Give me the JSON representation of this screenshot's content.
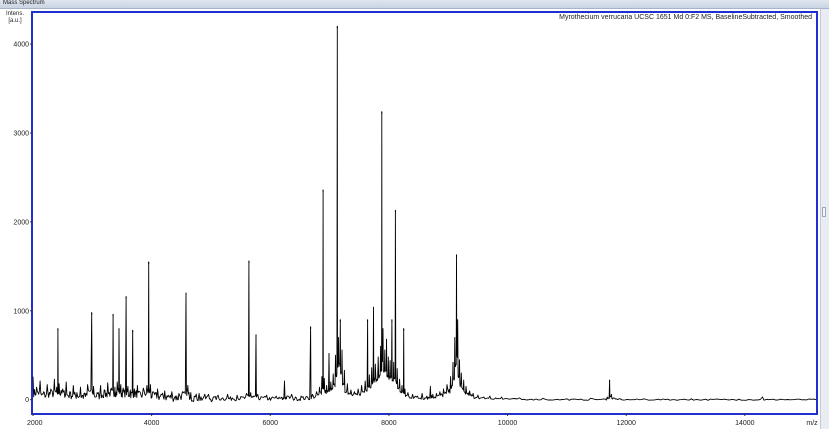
{
  "window": {
    "title": "Mass Spectrum"
  },
  "chart_data": {
    "type": "line",
    "title": "Myrothecium verrucaria UCSC 1651 Md 0:F2 MS, BaselineSubtracted, Smoothed",
    "xlabel": "m/z",
    "ylabel": "Intens. [a.u.]",
    "xlim": [
      2000,
      15200
    ],
    "ylim": [
      -150,
      4350
    ],
    "x_ticks": [
      2000,
      4000,
      6000,
      8000,
      10000,
      12000,
      14000
    ],
    "x_tick_labels": [
      "2000",
      "4000",
      "6000",
      "8000",
      "10000",
      "12000",
      "14000"
    ],
    "y_ticks": [
      0,
      1000,
      2000,
      3000,
      4000
    ],
    "y_tick_labels": [
      "0",
      "1000",
      "2000",
      "3000",
      "4000"
    ],
    "color": "#000000",
    "frame_color": "#1f2fd0",
    "peaks": [
      {
        "x": 2420,
        "y": 800
      },
      {
        "x": 2990,
        "y": 980
      },
      {
        "x": 3350,
        "y": 960
      },
      {
        "x": 3450,
        "y": 800
      },
      {
        "x": 3570,
        "y": 1160
      },
      {
        "x": 3680,
        "y": 780
      },
      {
        "x": 3950,
        "y": 1550
      },
      {
        "x": 4580,
        "y": 1200
      },
      {
        "x": 5640,
        "y": 1560
      },
      {
        "x": 5760,
        "y": 730
      },
      {
        "x": 6680,
        "y": 820
      },
      {
        "x": 6890,
        "y": 2360
      },
      {
        "x": 6990,
        "y": 520
      },
      {
        "x": 7130,
        "y": 4200
      },
      {
        "x": 7180,
        "y": 900
      },
      {
        "x": 7640,
        "y": 900
      },
      {
        "x": 7740,
        "y": 1040
      },
      {
        "x": 7880,
        "y": 3240
      },
      {
        "x": 7960,
        "y": 680
      },
      {
        "x": 8050,
        "y": 900
      },
      {
        "x": 8110,
        "y": 2130
      },
      {
        "x": 8250,
        "y": 800
      },
      {
        "x": 9140,
        "y": 1630
      },
      {
        "x": 11720,
        "y": 220
      }
    ],
    "series": [
      {
        "values": [
          [
            2000,
            260
          ],
          [
            2060,
            140
          ],
          [
            2120,
            210
          ],
          [
            2180,
            90
          ],
          [
            2240,
            170
          ],
          [
            2300,
            120
          ],
          [
            2360,
            230
          ],
          [
            2400,
            140
          ],
          [
            2420,
            800
          ],
          [
            2440,
            180
          ],
          [
            2500,
            120
          ],
          [
            2560,
            200
          ],
          [
            2620,
            90
          ],
          [
            2680,
            160
          ],
          [
            2740,
            80
          ],
          [
            2800,
            140
          ],
          [
            2860,
            70
          ],
          [
            2920,
            170
          ],
          [
            2990,
            980
          ],
          [
            3020,
            150
          ],
          [
            3080,
            80
          ],
          [
            3140,
            160
          ],
          [
            3200,
            110
          ],
          [
            3260,
            190
          ],
          [
            3320,
            130
          ],
          [
            3350,
            960
          ],
          [
            3380,
            140
          ],
          [
            3420,
            200
          ],
          [
            3450,
            800
          ],
          [
            3480,
            170
          ],
          [
            3520,
            130
          ],
          [
            3570,
            1160
          ],
          [
            3600,
            150
          ],
          [
            3640,
            110
          ],
          [
            3680,
            780
          ],
          [
            3710,
            120
          ],
          [
            3760,
            160
          ],
          [
            3800,
            90
          ],
          [
            3860,
            130
          ],
          [
            3920,
            160
          ],
          [
            3950,
            1550
          ],
          [
            3980,
            170
          ],
          [
            4040,
            80
          ],
          [
            4100,
            120
          ],
          [
            4160,
            60
          ],
          [
            4220,
            100
          ],
          [
            4280,
            50
          ],
          [
            4340,
            90
          ],
          [
            4400,
            40
          ],
          [
            4460,
            70
          ],
          [
            4520,
            90
          ],
          [
            4580,
            1200
          ],
          [
            4610,
            160
          ],
          [
            4660,
            80
          ],
          [
            4720,
            40
          ],
          [
            4800,
            70
          ],
          [
            4880,
            30
          ],
          [
            4960,
            60
          ],
          [
            5040,
            30
          ],
          [
            5120,
            50
          ],
          [
            5200,
            20
          ],
          [
            5280,
            60
          ],
          [
            5360,
            20
          ],
          [
            5440,
            50
          ],
          [
            5520,
            30
          ],
          [
            5600,
            70
          ],
          [
            5640,
            1560
          ],
          [
            5670,
            80
          ],
          [
            5710,
            40
          ],
          [
            5760,
            730
          ],
          [
            5790,
            60
          ],
          [
            5860,
            30
          ],
          [
            5940,
            50
          ],
          [
            6020,
            20
          ],
          [
            6100,
            40
          ],
          [
            6180,
            20
          ],
          [
            6240,
            210
          ],
          [
            6280,
            40
          ],
          [
            6360,
            60
          ],
          [
            6440,
            20
          ],
          [
            6520,
            40
          ],
          [
            6600,
            30
          ],
          [
            6680,
            820
          ],
          [
            6710,
            60
          ],
          [
            6780,
            90
          ],
          [
            6830,
            140
          ],
          [
            6870,
            260
          ],
          [
            6890,
            2360
          ],
          [
            6910,
            240
          ],
          [
            6950,
            160
          ],
          [
            6990,
            520
          ],
          [
            7020,
            200
          ],
          [
            7060,
            290
          ],
          [
            7100,
            500
          ],
          [
            7130,
            4200
          ],
          [
            7150,
            700
          ],
          [
            7180,
            900
          ],
          [
            7210,
            560
          ],
          [
            7250,
            330
          ],
          [
            7300,
            180
          ],
          [
            7360,
            110
          ],
          [
            7420,
            90
          ],
          [
            7480,
            120
          ],
          [
            7540,
            160
          ],
          [
            7600,
            210
          ],
          [
            7640,
            900
          ],
          [
            7670,
            280
          ],
          [
            7710,
            360
          ],
          [
            7740,
            1040
          ],
          [
            7770,
            400
          ],
          [
            7820,
            480
          ],
          [
            7860,
            600
          ],
          [
            7880,
            3240
          ],
          [
            7900,
            800
          ],
          [
            7930,
            560
          ],
          [
            7960,
            680
          ],
          [
            7990,
            480
          ],
          [
            8020,
            440
          ],
          [
            8050,
            900
          ],
          [
            8080,
            420
          ],
          [
            8110,
            2130
          ],
          [
            8140,
            350
          ],
          [
            8180,
            230
          ],
          [
            8220,
            160
          ],
          [
            8250,
            800
          ],
          [
            8270,
            120
          ],
          [
            8320,
            80
          ],
          [
            8400,
            60
          ],
          [
            8480,
            40
          ],
          [
            8560,
            70
          ],
          [
            8640,
            40
          ],
          [
            8700,
            150
          ],
          [
            8740,
            60
          ],
          [
            8800,
            70
          ],
          [
            8860,
            90
          ],
          [
            8920,
            120
          ],
          [
            8980,
            170
          ],
          [
            9040,
            260
          ],
          [
            9080,
            420
          ],
          [
            9110,
            700
          ],
          [
            9140,
            1630
          ],
          [
            9160,
            900
          ],
          [
            9190,
            450
          ],
          [
            9220,
            300
          ],
          [
            9260,
            220
          ],
          [
            9300,
            150
          ],
          [
            9360,
            100
          ],
          [
            9420,
            70
          ],
          [
            9500,
            50
          ],
          [
            9600,
            30
          ],
          [
            9700,
            40
          ],
          [
            9800,
            20
          ],
          [
            9900,
            30
          ],
          [
            10000,
            10
          ],
          [
            10200,
            20
          ],
          [
            10400,
            5
          ],
          [
            10600,
            15
          ],
          [
            10800,
            0
          ],
          [
            11000,
            10
          ],
          [
            11200,
            0
          ],
          [
            11400,
            15
          ],
          [
            11600,
            5
          ],
          [
            11680,
            30
          ],
          [
            11720,
            220
          ],
          [
            11750,
            60
          ],
          [
            11800,
            20
          ],
          [
            11900,
            10
          ],
          [
            12100,
            0
          ],
          [
            12300,
            10
          ],
          [
            12500,
            0
          ],
          [
            12700,
            5
          ],
          [
            12900,
            0
          ],
          [
            13100,
            10
          ],
          [
            13300,
            0
          ],
          [
            13500,
            5
          ],
          [
            13700,
            0
          ],
          [
            13900,
            5
          ],
          [
            14100,
            0
          ],
          [
            14300,
            30
          ],
          [
            14400,
            0
          ],
          [
            14600,
            5
          ],
          [
            14800,
            0
          ],
          [
            15000,
            0
          ],
          [
            15200,
            0
          ]
        ]
      }
    ]
  }
}
